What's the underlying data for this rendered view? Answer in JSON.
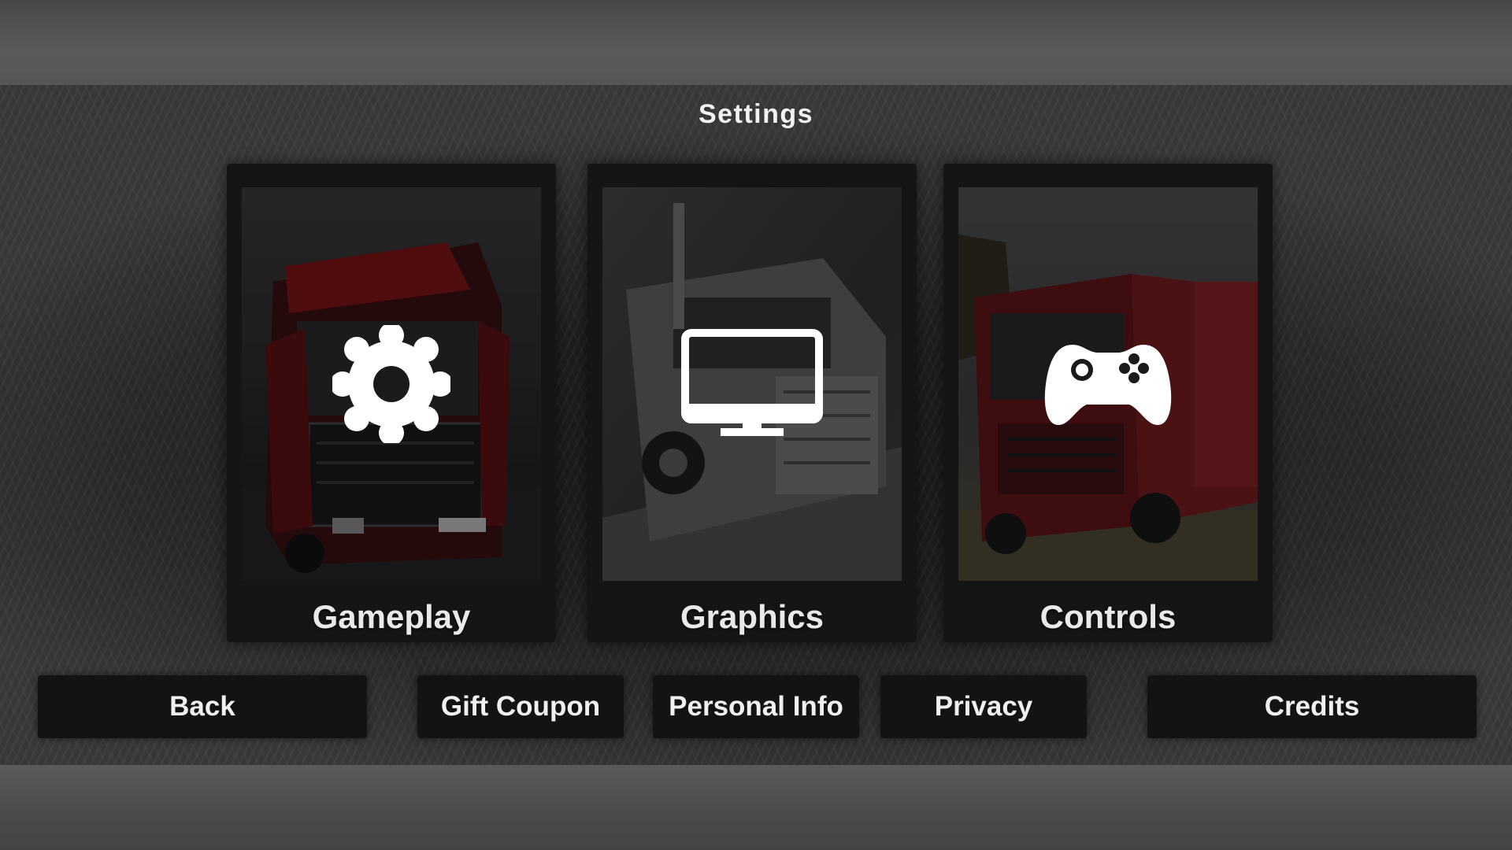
{
  "screen": {
    "title": "Settings"
  },
  "cards": [
    {
      "label": "Gameplay",
      "icon": "gear-icon"
    },
    {
      "label": "Graphics",
      "icon": "monitor-icon"
    },
    {
      "label": "Controls",
      "icon": "gamepad-icon"
    }
  ],
  "buttons": {
    "back": "Back",
    "gift_coupon": "Gift Coupon",
    "personal_info": "Personal Info",
    "privacy": "Privacy",
    "credits": "Credits"
  },
  "colors": {
    "truck_red": "#8a1418",
    "panel": "#151515",
    "text": "#f0f0f0"
  }
}
